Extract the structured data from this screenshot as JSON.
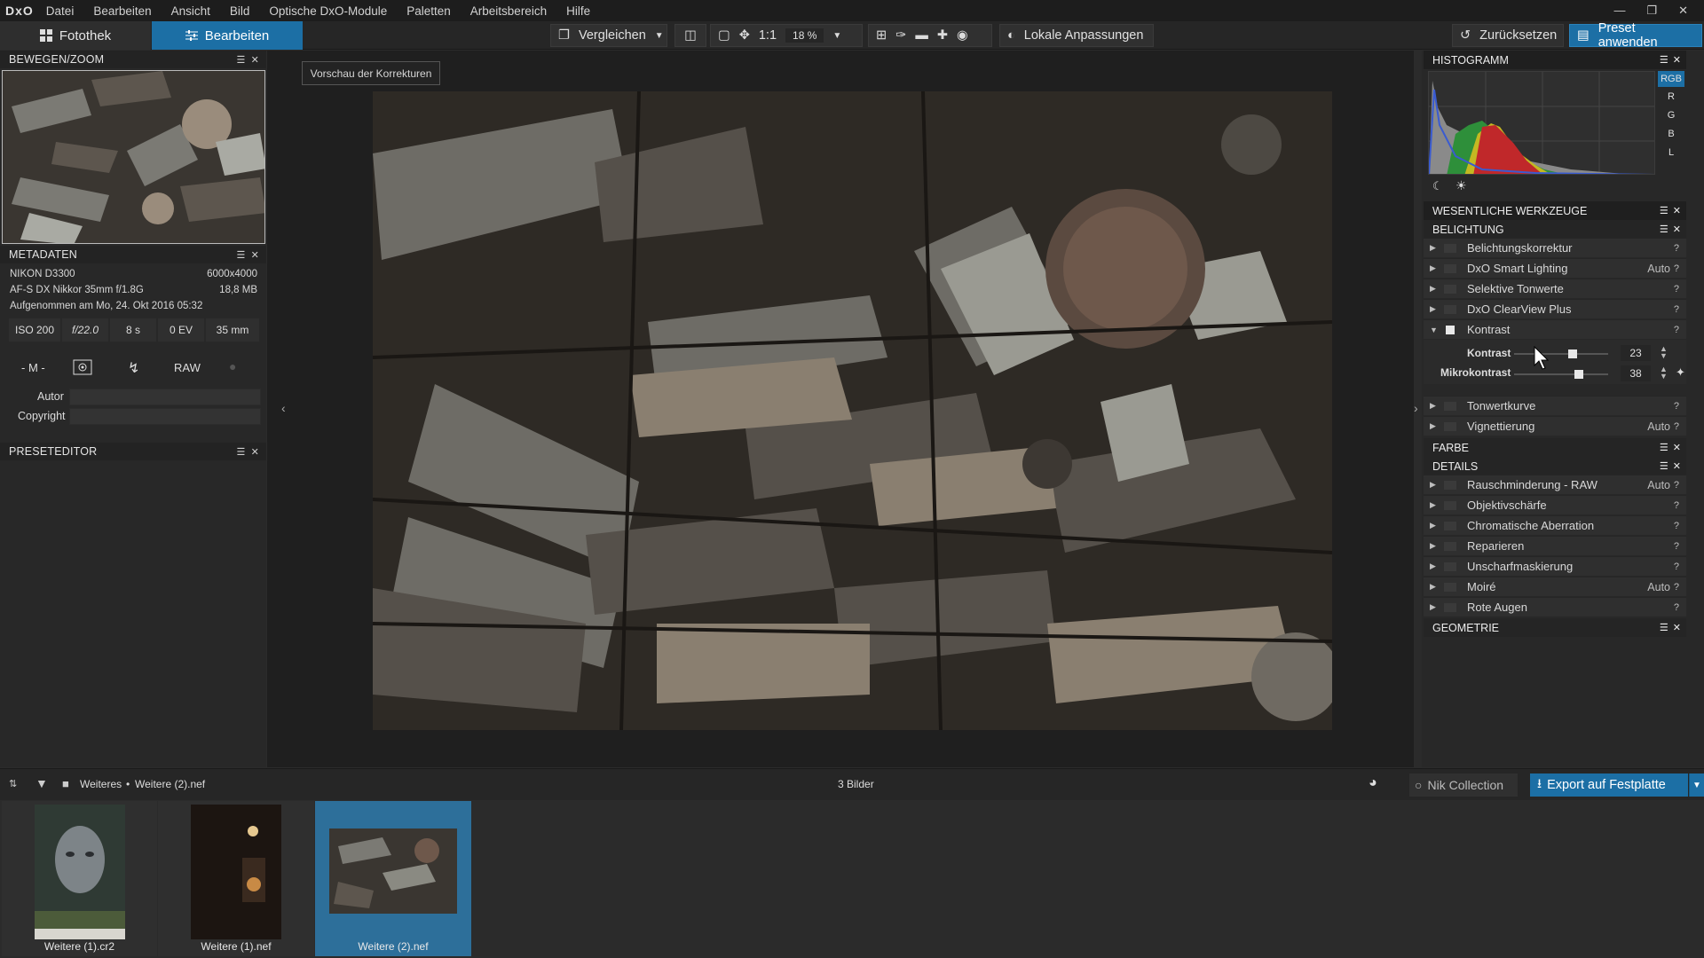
{
  "menubar": {
    "logo": "DxO",
    "items": [
      "Datei",
      "Bearbeiten",
      "Ansicht",
      "Bild",
      "Optische DxO-Module",
      "Paletten",
      "Arbeitsbereich",
      "Hilfe"
    ]
  },
  "toolbar": {
    "tab_fotothek": "Fotothek",
    "tab_bearbeiten": "Bearbeiten",
    "vergleichen": "Vergleichen",
    "zoom_1to1": "1:1",
    "zoom_level": "18 %",
    "lokale_anpassungen": "Lokale Anpassungen",
    "zuruecksetzen": "Zurücksetzen",
    "preset_anwenden": "Preset anwenden"
  },
  "left": {
    "nav_title": "BEWEGEN/ZOOM",
    "meta_title": "METADATEN",
    "camera": "NIKON D3300",
    "resolution": "6000x4000",
    "lens": "AF-S DX Nikkor 35mm f/1.8G",
    "filesize": "18,8 MB",
    "date": "Aufgenommen am Mo, 24. Okt 2016 05:32",
    "iso": "ISO 200",
    "aperture": "f/22.0",
    "shutter": "8 s",
    "ev": "0 EV",
    "focal": "35 mm",
    "mode": "- M -",
    "format": "RAW",
    "autor_label": "Autor",
    "copyright_label": "Copyright",
    "preset_title": "PRESETEDITOR"
  },
  "center": {
    "preview_label": "Vorschau der Korrekturen"
  },
  "right": {
    "histogram_title": "HISTOGRAMM",
    "channels": [
      "RGB",
      "R",
      "G",
      "B",
      "L"
    ],
    "sections": {
      "wesentliche": "WESENTLICHE WERKZEUGE",
      "belichtung": "BELICHTUNG",
      "farbe": "FARBE",
      "details": "DETAILS",
      "geometrie": "GEOMETRIE"
    },
    "belichtung_tools": [
      {
        "label": "Belichtungskorrektur",
        "auto": ""
      },
      {
        "label": "DxO Smart Lighting",
        "auto": "Auto"
      },
      {
        "label": "Selektive Tonwerte",
        "auto": ""
      },
      {
        "label": "DxO ClearView Plus",
        "auto": ""
      },
      {
        "label": "Kontrast",
        "auto": ""
      }
    ],
    "kontrast": {
      "label": "Kontrast",
      "value": "23",
      "level": 0.62
    },
    "mikrokontrast": {
      "label": "Mikrokontrast",
      "value": "38",
      "level": 0.69
    },
    "after_tools": [
      {
        "label": "Tonwertkurve",
        "auto": ""
      },
      {
        "label": "Vignettierung",
        "auto": "Auto"
      }
    ],
    "details_tools": [
      {
        "label": "Rauschminderung - RAW",
        "auto": "Auto"
      },
      {
        "label": "Objektivschärfe",
        "auto": ""
      },
      {
        "label": "Chromatische Aberration",
        "auto": ""
      },
      {
        "label": "Reparieren",
        "auto": ""
      },
      {
        "label": "Unscharfmaskierung",
        "auto": ""
      },
      {
        "label": "Moiré",
        "auto": "Auto"
      },
      {
        "label": "Rote Augen",
        "auto": ""
      }
    ],
    "help": "?"
  },
  "bottom": {
    "path_1": "Weiteres",
    "path_sep": "•",
    "path_2": "Weitere (2).nef",
    "count": "3 Bilder",
    "nik": "Nik Collection",
    "export": "Export auf Festplatte"
  },
  "filmstrip": [
    {
      "name": "Weitere (1).cr2"
    },
    {
      "name": "Weitere (1).nef"
    },
    {
      "name": "Weitere (2).nef"
    }
  ],
  "colors": {
    "accent": "#1c6fa5",
    "selected_thumb": "#2d6f9a"
  }
}
